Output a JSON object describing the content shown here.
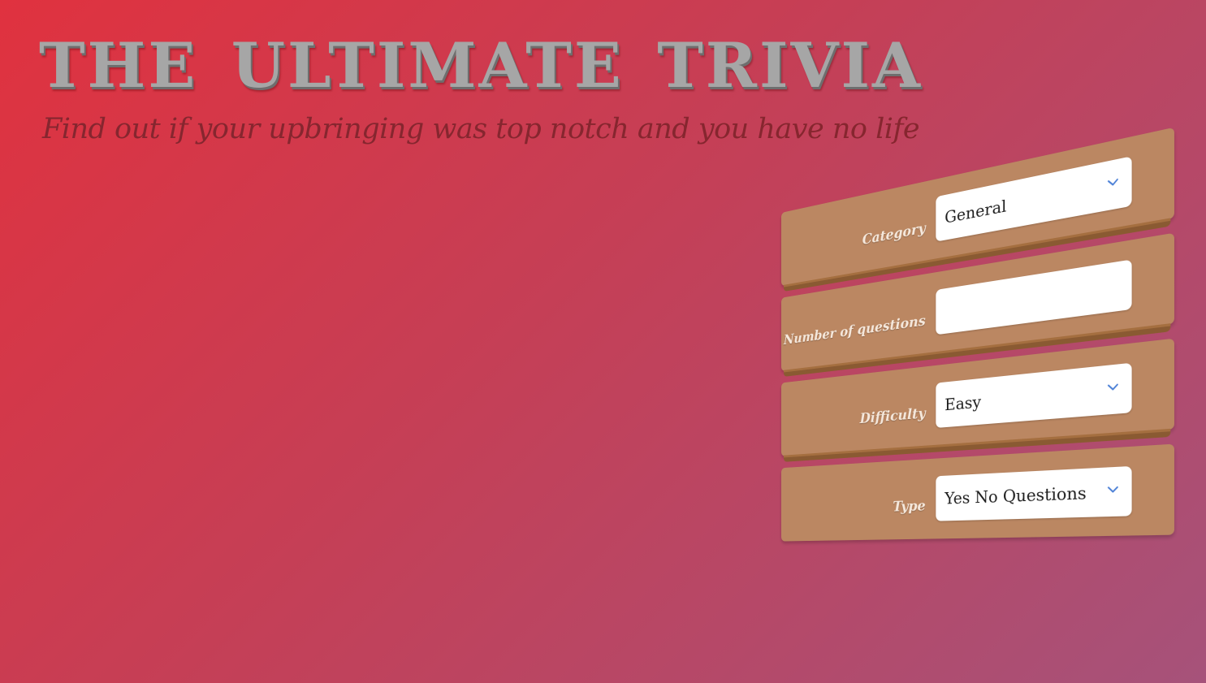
{
  "header": {
    "title": "THE  ULTIMATE  TRIVIA",
    "subtitle": "Find out if your upbringing was top notch and you have no life"
  },
  "form": {
    "category": {
      "label": "Category",
      "value": "General",
      "icon": "chevron-down-icon"
    },
    "number_of_questions": {
      "label": "Number of questions",
      "value": "",
      "placeholder": ""
    },
    "difficulty": {
      "label": "Difficulty",
      "value": "Easy",
      "icon": "chevron-down-icon"
    },
    "type": {
      "label": "Type",
      "value": "Yes No Questions",
      "icon": "chevron-down-icon"
    }
  },
  "colors": {
    "background_start": "#e0323f",
    "background_end": "#a6527a",
    "plank": "#bb8762",
    "plank_edge": "#8a5a32",
    "title": "#a6a6a6",
    "subtitle": "#86262f",
    "chevron": "#4a7fd6"
  }
}
